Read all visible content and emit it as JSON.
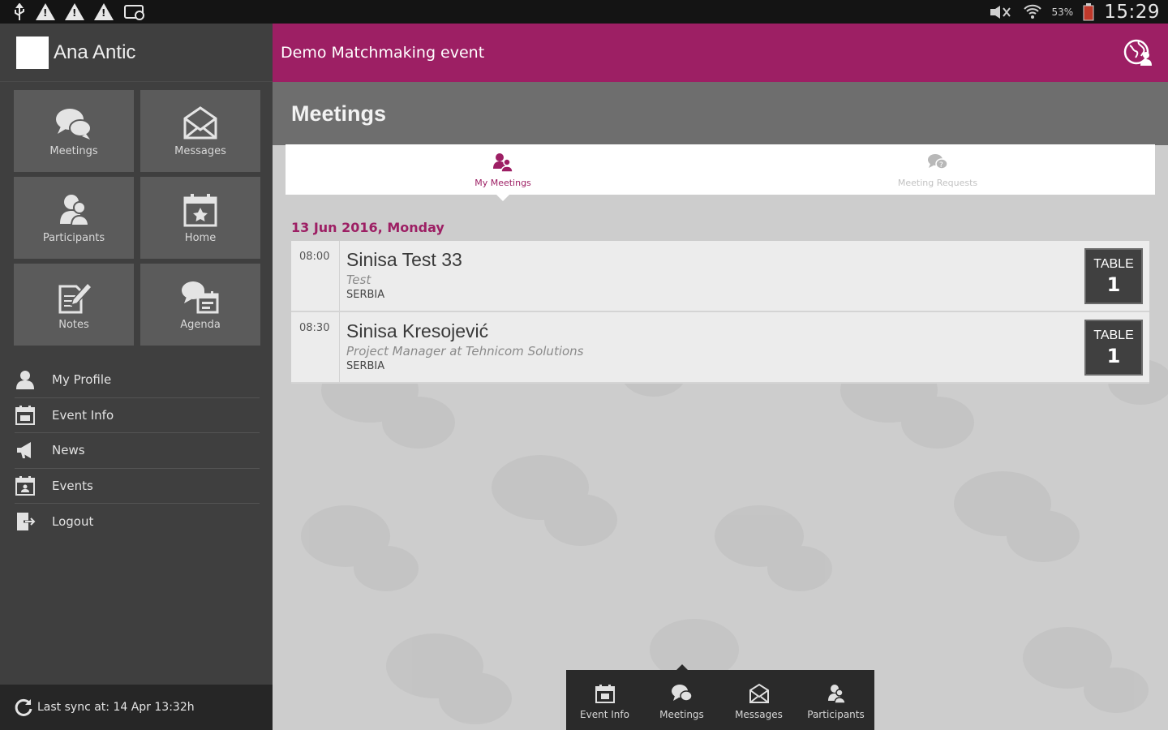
{
  "statusbar": {
    "battery": "53%",
    "time": "15:29"
  },
  "sidebar": {
    "user_name": "Ana Antic",
    "tiles": [
      {
        "label": "Meetings",
        "icon": "chat-bubbles-icon"
      },
      {
        "label": "Messages",
        "icon": "envelope-icon"
      },
      {
        "label": "Participants",
        "icon": "participants-icon"
      },
      {
        "label": "Home",
        "icon": "calendar-star-icon"
      },
      {
        "label": "Notes",
        "icon": "notes-pen-icon"
      },
      {
        "label": "Agenda",
        "icon": "agenda-icon"
      }
    ],
    "menu": [
      {
        "label": "My Profile",
        "icon": "user-icon"
      },
      {
        "label": "Event Info",
        "icon": "calendar-icon"
      },
      {
        "label": "News",
        "icon": "megaphone-icon"
      },
      {
        "label": "Events",
        "icon": "events-icon"
      },
      {
        "label": "Logout",
        "icon": "logout-icon"
      }
    ],
    "sync": "Last sync at: 14 Apr 13:32h"
  },
  "topbar": {
    "title": "Demo Matchmaking event",
    "globe_icon": "globe-icon"
  },
  "main": {
    "page_title": "Meetings",
    "tabs": [
      {
        "label": "My Meetings",
        "active": true
      },
      {
        "label": "Meeting Requests",
        "active": false
      }
    ],
    "date": "13 Jun 2016, Monday",
    "meetings": [
      {
        "time": "08:00",
        "name": "Sinisa Test 33",
        "role": "Test",
        "country": "SERBIA",
        "table_label": "TABLE",
        "table_number": "1"
      },
      {
        "time": "08:30",
        "name": "Sinisa Kresojević",
        "role": "Project Manager at Tehnicom Solutions",
        "country": "SERBIA",
        "table_label": "TABLE",
        "table_number": "1"
      }
    ]
  },
  "bottombar": {
    "items": [
      {
        "label": "Event Info"
      },
      {
        "label": "Meetings",
        "active": true
      },
      {
        "label": "Messages"
      },
      {
        "label": "Participants"
      }
    ]
  },
  "colors": {
    "accent": "#9d1f64",
    "sidebar": "#3f3f3f",
    "tile": "#5b5b5b"
  }
}
